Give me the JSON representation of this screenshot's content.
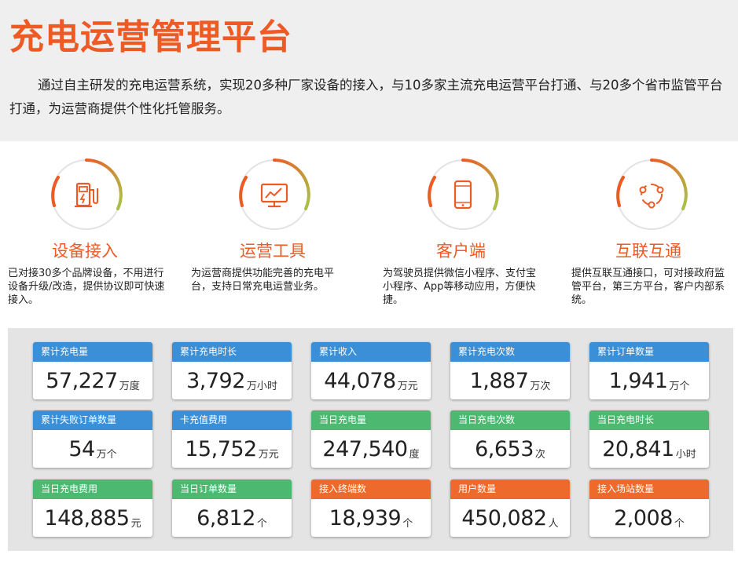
{
  "header": {
    "title": "充电运营管理平台",
    "intro": "通过自主研发的充电运营系统，实现20多种厂家设备的接入，与10多家主流充电运营平台打通、与20多个省市监管平台打通，为运营商提供个性化托管服务。"
  },
  "features": [
    {
      "title": "设备接入",
      "desc": "已对接30多个品牌设备，不用进行设备升级/改造，提供协议即可快速接入。",
      "icon": "charging-pile-icon"
    },
    {
      "title": "运营工具",
      "desc": "为运营商提供功能完善的充电平台，支持日常充电运营业务。",
      "icon": "monitor-chart-icon"
    },
    {
      "title": "客户端",
      "desc": "为驾驶员提供微信小程序、支付宝小程序、App等移动应用，方便快捷。",
      "icon": "mobile-phone-icon"
    },
    {
      "title": "互联互通",
      "desc": "提供互联互通接口，可对接政府监管平台，第三方平台，客户内部系统。",
      "icon": "network-share-icon"
    }
  ],
  "colors": {
    "accent": "#ee5a24",
    "blue": "#3a8fd6",
    "green": "#4cb870",
    "orange": "#ee6a2c"
  },
  "stats": [
    {
      "label": "累计充电量",
      "value": "57,227",
      "unit": "万度",
      "color": "blue"
    },
    {
      "label": "累计充电时长",
      "value": "3,792",
      "unit": "万小时",
      "color": "blue"
    },
    {
      "label": "累计收入",
      "value": "44,078",
      "unit": "万元",
      "color": "blue"
    },
    {
      "label": "累计充电次数",
      "value": "1,887",
      "unit": "万次",
      "color": "blue"
    },
    {
      "label": "累计订单数量",
      "value": "1,941",
      "unit": "万个",
      "color": "blue"
    },
    {
      "label": "累计失败订单数量",
      "value": "54",
      "unit": "万个",
      "color": "blue"
    },
    {
      "label": "卡充值费用",
      "value": "15,752",
      "unit": "万元",
      "color": "blue"
    },
    {
      "label": "当日充电量",
      "value": "247,540",
      "unit": "度",
      "color": "green"
    },
    {
      "label": "当日充电次数",
      "value": "6,653",
      "unit": "次",
      "color": "green"
    },
    {
      "label": "当日充电时长",
      "value": "20,841",
      "unit": "小时",
      "color": "green"
    },
    {
      "label": "当日充电费用",
      "value": "148,885",
      "unit": "元",
      "color": "green"
    },
    {
      "label": "当日订单数量",
      "value": "6,812",
      "unit": "个",
      "color": "green"
    },
    {
      "label": "接入终端数",
      "value": "18,939",
      "unit": "个",
      "color": "orange"
    },
    {
      "label": "用户数量",
      "value": "450,082",
      "unit": "人",
      "color": "orange"
    },
    {
      "label": "接入场站数量",
      "value": "2,008",
      "unit": "个",
      "color": "orange"
    }
  ]
}
